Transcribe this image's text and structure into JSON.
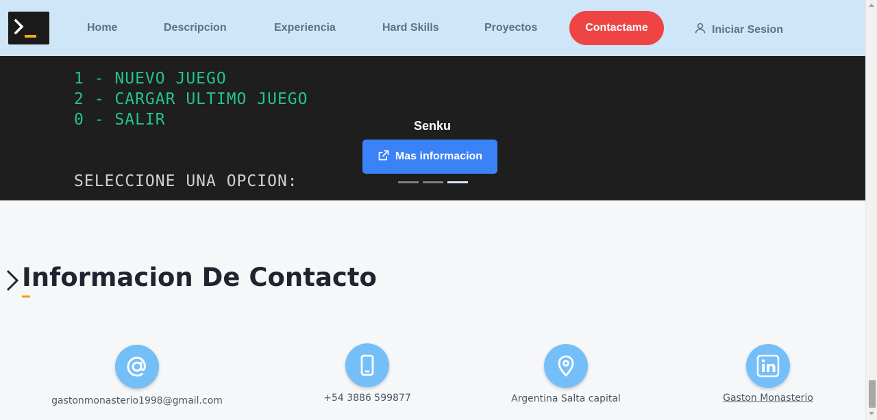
{
  "nav": {
    "logo_icon": "terminal-icon",
    "links": [
      "Home",
      "Descripcion",
      "Experiencia",
      "Hard Skills",
      "Proyectos"
    ],
    "contact_label": "Contactame",
    "login_label": "Iniciar Sesion",
    "login_icon": "user-icon"
  },
  "hero": {
    "terminal_lines": {
      "line1": "1 - NUEVO JUEGO",
      "line2": "2 - CARGAR ULTIMO JUEGO",
      "line3": "0 - SALIR",
      "prompt": "SELECCIONE UNA OPCION:"
    },
    "slide_title": "Senku",
    "more_info_label": "Mas informacion",
    "slides_count": 3,
    "active_slide": 3
  },
  "contact": {
    "title": "Informacion De Contacto",
    "items": [
      {
        "icon": "at-icon",
        "text": "gastonmonasterio1998@gmail.com"
      },
      {
        "icon": "phone-icon",
        "text": "+54 3886 599877"
      },
      {
        "icon": "location-pin-icon",
        "text": "Argentina Salta capital"
      },
      {
        "icon": "linkedin-icon",
        "text": "Gaston Monasterio"
      }
    ]
  },
  "colors": {
    "nav_bg": "#cfe5f8",
    "accent_red": "#ef4444",
    "accent_blue": "#3b82f6",
    "icon_circle": "#74bff8",
    "terminal_green": "#23c48e",
    "underline_orange": "#f59e0b"
  }
}
